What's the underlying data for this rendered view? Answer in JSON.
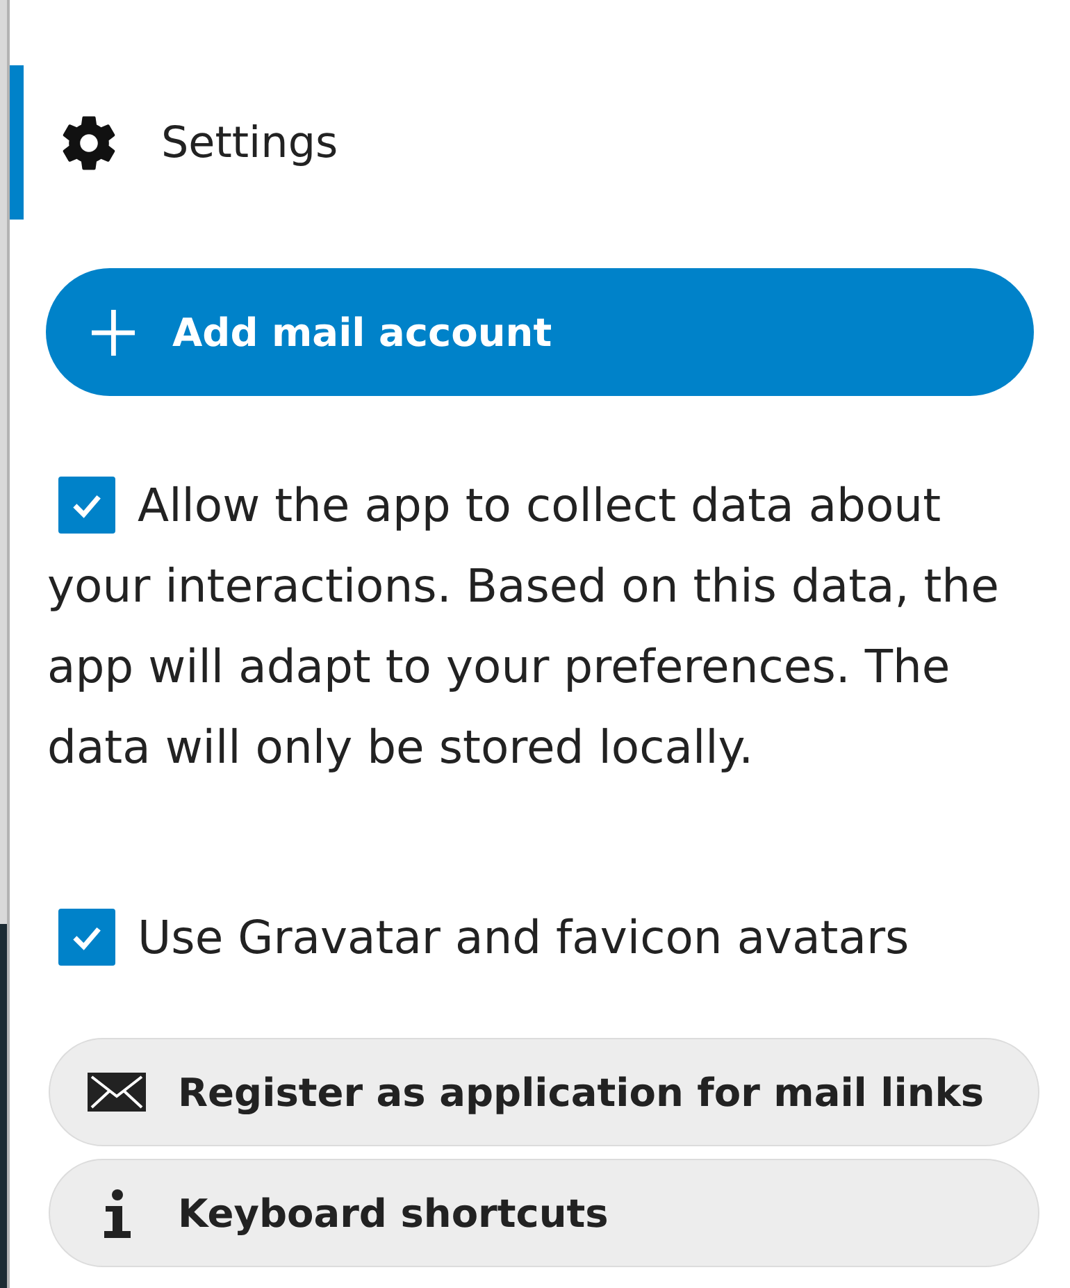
{
  "nav_item": {
    "label": "Settings",
    "selected": true
  },
  "add_account_button": {
    "label": "Add mail account"
  },
  "options": [
    {
      "label": "Allow the app to collect data about your interactions. Based on this data, the app will adapt to your preferences. The data will only be stored locally.",
      "checked": true
    },
    {
      "label": "Use Gravatar and favicon avatars",
      "checked": true
    }
  ],
  "actions": [
    {
      "kind": "mail",
      "label": "Register as application for mail links"
    },
    {
      "kind": "info",
      "label": "Keyboard shortcuts"
    }
  ]
}
